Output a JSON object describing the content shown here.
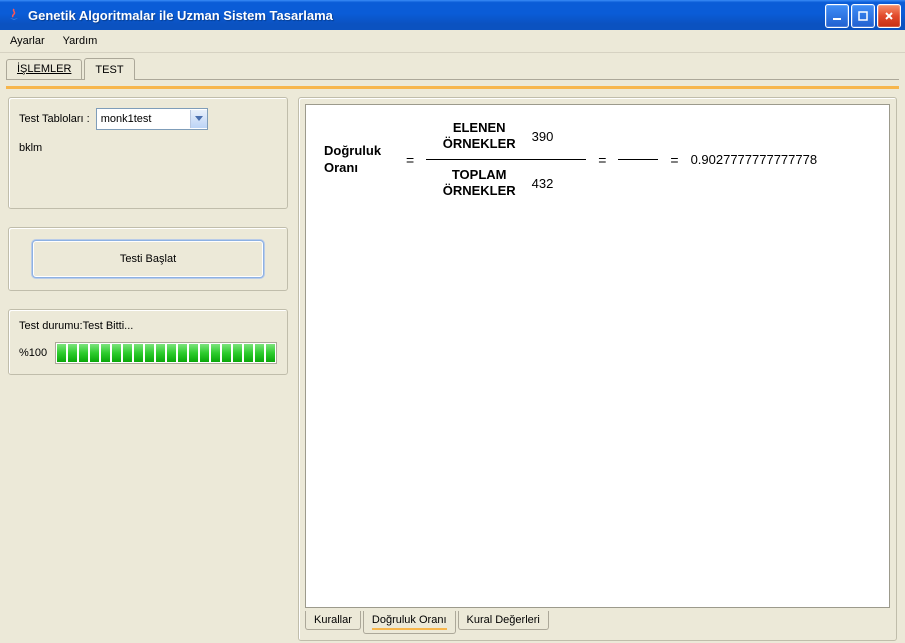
{
  "window": {
    "title": "Genetik Algoritmalar ile Uzman Sistem Tasarlama"
  },
  "menu": {
    "settings": "Ayarlar",
    "help": "Yardım"
  },
  "mainTabs": {
    "operations": "İŞLEMLER",
    "test": "TEST"
  },
  "left": {
    "tableLabel": "Test Tabloları  :",
    "tableSelected": "monk1test",
    "extraText": "bklm",
    "startBtn": "Testi Başlat",
    "statusLabel": "Test durumu:Test Bitti...",
    "percentLabel": "%100"
  },
  "formula": {
    "lhsL1": "Doğruluk",
    "lhsL2": "Oranı",
    "topLabelL1": "ELENEN",
    "topLabelL2": "ÖRNEKLER",
    "topValue": "390",
    "bottomLabelL1": "TOPLAM",
    "bottomLabelL2": "ÖRNEKLER",
    "bottomValue": "432",
    "result": "0.9027777777777778"
  },
  "innerTabs": {
    "rules": "Kurallar",
    "accuracy": "Doğruluk Oranı",
    "ruleValues": "Kural Değerleri"
  }
}
